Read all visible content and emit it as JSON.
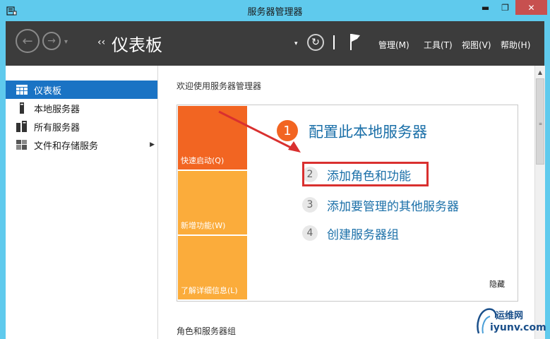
{
  "window": {
    "title": "服务器管理器",
    "min_glyph": "▬",
    "max_glyph": "❐",
    "close_glyph": "✕"
  },
  "header": {
    "back_glyph": "←",
    "forward_glyph": "→",
    "dropdown_glyph": "▾",
    "crumb_chevron": "‹‹",
    "page_title": "仪表板",
    "refresh_glyph": "↻",
    "menus": [
      "管理(M)",
      "工具(T)",
      "视图(V)",
      "帮助(H)"
    ]
  },
  "sidebar": {
    "items": [
      {
        "label": "仪表板",
        "icon": "dashboard-icon",
        "active": true
      },
      {
        "label": "本地服务器",
        "icon": "local-server-icon",
        "active": false
      },
      {
        "label": "所有服务器",
        "icon": "all-servers-icon",
        "active": false
      },
      {
        "label": "文件和存储服务",
        "icon": "file-storage-icon",
        "active": false,
        "has_submenu": true
      }
    ],
    "submenu_arrow": "▶"
  },
  "main": {
    "welcome_title": "欢迎使用服务器管理器",
    "tiles": [
      "快速启动(Q)",
      "新增功能(W)",
      "了解详细信息(L)"
    ],
    "steps": [
      {
        "num": "1",
        "label": "配置此本地服务器"
      },
      {
        "num": "2",
        "label": "添加角色和功能"
      },
      {
        "num": "3",
        "label": "添加要管理的其他服务器"
      },
      {
        "num": "4",
        "label": "创建服务器组"
      }
    ],
    "hide_label": "隐藏",
    "roles_header": "角色和服务器组"
  },
  "scrollbar": {
    "up_glyph": "▲",
    "grip_glyph": "≡"
  },
  "watermark": {
    "cn": "运维网",
    "en": "iyunv.com"
  },
  "colors": {
    "titlebar": "#5fcaed",
    "header": "#3c3c3c",
    "active_item": "#1a73c4",
    "tile_primary": "#f26522",
    "tile_secondary": "#fbac3b",
    "link": "#1a6fa8",
    "annotation": "#d9302f"
  }
}
